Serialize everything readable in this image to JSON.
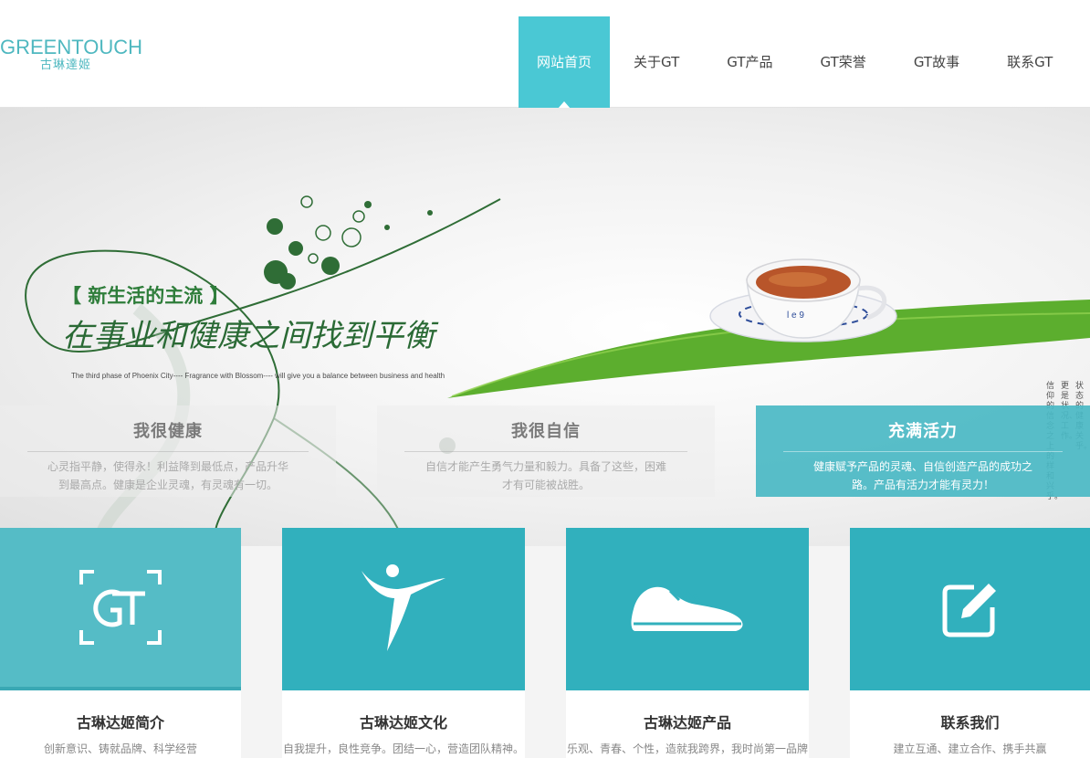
{
  "header": {
    "logo_en": "GREENTOUCH",
    "logo_cn": "古琳達姬",
    "nav": [
      {
        "label": "网站首页",
        "active": true
      },
      {
        "label": "关于GT",
        "active": false
      },
      {
        "label": "GT产品",
        "active": false
      },
      {
        "label": "GT荣誉",
        "active": false
      },
      {
        "label": "GT故事",
        "active": false
      },
      {
        "label": "联系GT",
        "active": false
      }
    ]
  },
  "hero": {
    "tag": "【 新生活的主流 】",
    "headline": "在事业和健康之间找到平衡",
    "subline": "The third phase of Phoenix City---- Fragrance with Blossom---- will give you a balance between business and health",
    "vertical_text_1": "状态的健康关乎。",
    "vertical_text_2": "更是状况、工作。",
    "vertical_text_3": "信仰的信念之上的样和兴乎。",
    "features": [
      {
        "title": "我很健康",
        "desc": "心灵指平静，使得永！利益降到最低点，产品升华到最高点。健康是企业灵魂，有灵魂有一切。",
        "active": false
      },
      {
        "title": "我很自信",
        "desc": "自信才能产生勇气力量和毅力。具备了这些，困难才有可能被战胜。",
        "active": false
      },
      {
        "title": "充满活力",
        "desc": "健康赋予产品的灵魂、自信创造产品的成功之路。产品有活力才能有灵力！",
        "active": true
      }
    ]
  },
  "cards": [
    {
      "title": "古琳达姬简介",
      "desc": "创新意识、铸就品牌、科学经营",
      "icon": "gt-logo-icon"
    },
    {
      "title": "古琳达姬文化",
      "desc": "自我提升，良性竞争。团结一心，营造团队精神。",
      "icon": "dancer-icon"
    },
    {
      "title": "古琳达姬产品",
      "desc": "乐观、青春、个性，造就我跨界，我时尚第一品牌",
      "icon": "sneaker-icon"
    },
    {
      "title": "联系我们",
      "desc": "建立互通、建立合作、携手共赢",
      "icon": "edit-icon"
    }
  ],
  "colors": {
    "accent": "#4ac8d4",
    "card": "#31b0bd",
    "leaf": "#5cae2e",
    "dark_green": "#2a6a35"
  }
}
